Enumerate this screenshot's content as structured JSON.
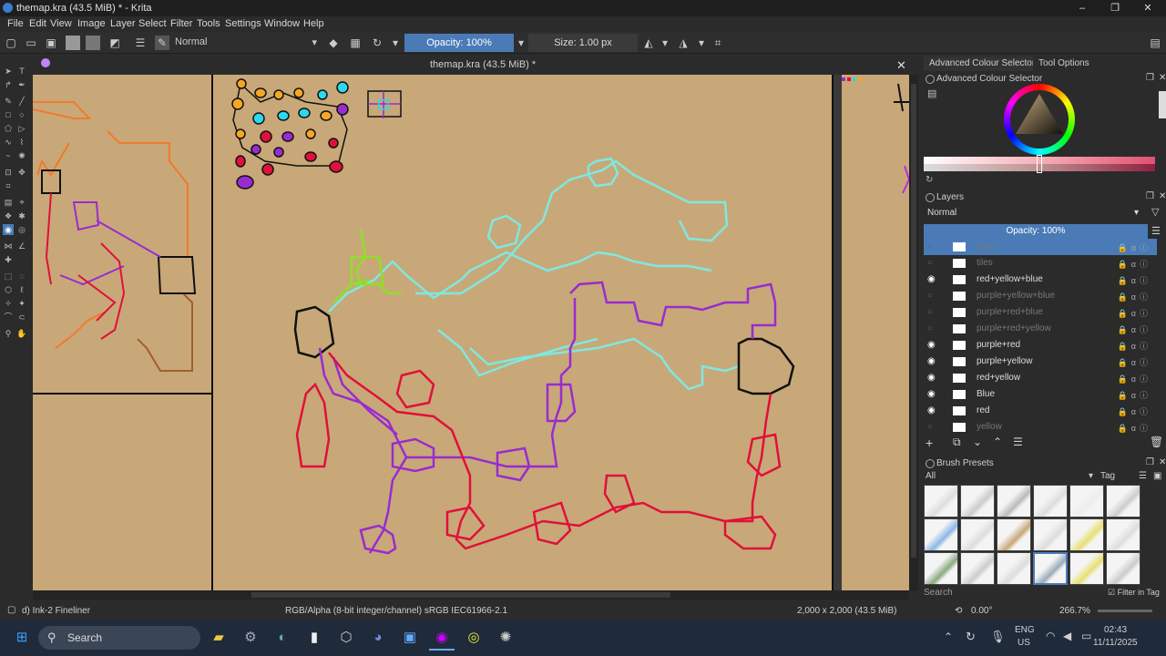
{
  "window": {
    "title": "themap.kra (43.5 MiB) * - Krita",
    "min": "–",
    "max": "❐",
    "close": "✕"
  },
  "menu": [
    "File",
    "Edit",
    "View",
    "Image",
    "Layer",
    "Select",
    "Filter",
    "Tools",
    "Settings",
    "Window",
    "Help"
  ],
  "toolbar": {
    "blend_mode": "Normal",
    "opacity": "Opacity: 100%",
    "size": "Size: 1.00 px"
  },
  "document": {
    "tab_title": "themap.kra (43.5 MiB) *",
    "close": "✕"
  },
  "right_tabs": {
    "advanced_colour": "Advanced Colour Selector",
    "tool_options": "Tool Options"
  },
  "colour_selector": {
    "title": "Advanced Colour Selector"
  },
  "layers": {
    "title": "Layers",
    "blend_mode": "Normal",
    "opacity": "Opacity:  100%",
    "items": [
      {
        "name": "cyan",
        "visible": false,
        "dim": true
      },
      {
        "name": "tiles",
        "visible": false,
        "dim": true
      },
      {
        "name": "red+yellow+blue",
        "visible": true,
        "dim": false
      },
      {
        "name": "purple+yellow+blue",
        "visible": false,
        "dim": true
      },
      {
        "name": "purple+red+blue",
        "visible": false,
        "dim": true
      },
      {
        "name": "purple+red+yellow",
        "visible": false,
        "dim": true
      },
      {
        "name": "purple+red",
        "visible": true,
        "dim": false
      },
      {
        "name": "purple+yellow",
        "visible": true,
        "dim": false
      },
      {
        "name": "red+yellow",
        "visible": true,
        "dim": false
      },
      {
        "name": "Blue",
        "visible": true,
        "dim": false
      },
      {
        "name": "red",
        "visible": true,
        "dim": false
      },
      {
        "name": "yellow",
        "visible": false,
        "dim": true
      }
    ]
  },
  "brush_presets": {
    "title": "Brush Presets",
    "filter": "All",
    "tag": "Tag",
    "search_placeholder": "Search",
    "filter_in_tag": "Filter in Tag"
  },
  "status": {
    "brush": "d) Ink-2 Fineliner",
    "color_space": "RGB/Alpha (8-bit integer/channel)  sRGB IEC61966-2.1",
    "dimensions": "2,000 x 2,000 (43.5 MiB)",
    "rotation": "0.00°",
    "zoom": "266.7%"
  },
  "taskbar": {
    "search": "Search",
    "lang": "ENG",
    "region": "US",
    "time": "02:43",
    "date": "11/11/2025"
  },
  "colors": {
    "accent": "#4a7bb7",
    "canvas_bg": "#c8a878",
    "cyan": "#7fe8e0",
    "purple": "#9a2bd0",
    "red": "#e0103a",
    "orange": "#f07a2a",
    "green": "#8ee028"
  }
}
